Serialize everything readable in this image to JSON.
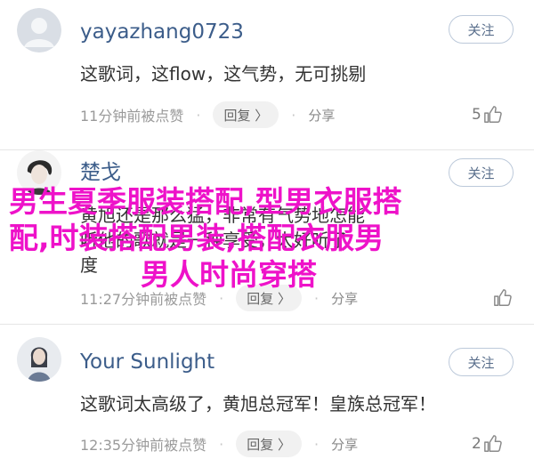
{
  "comments": [
    {
      "username": "yayazhang0723",
      "follow_label": "关注",
      "text": "这歌词，这flow，这气势，无可挑剔",
      "time": "11分钟前被点赞",
      "reply_label": "回复 〉",
      "share_label": "分享",
      "like_count": "5"
    },
    {
      "username": "楚戈",
      "follow_label": "关注",
      "text_lines": [
        "黄旭还是那么猛，非常有气势地怎能",
        "听他的歌就是一种享受，太好听了",
        "度"
      ],
      "time": "11:27分钟前被点赞",
      "reply_label": "回复 〉",
      "share_label": "分享",
      "like_count": ""
    },
    {
      "username": "Your Sunlight",
      "follow_label": "关注",
      "text": "这歌词太高级了，黄旭总冠军！皇族总冠军！",
      "time": "12:35分钟前被点赞",
      "reply_label": "回复 〉",
      "share_label": "分享",
      "like_count": "2"
    }
  ],
  "overlay": {
    "line1": "男生夏季服装搭配,型男衣服搭",
    "line2": "配,时装搭配男装,搭配衣服男",
    "line3": "男人时尚穿搭",
    "color": "#ee12c9"
  },
  "icons": {
    "like": "thumbs-up-icon",
    "dot": "separator-dot"
  }
}
